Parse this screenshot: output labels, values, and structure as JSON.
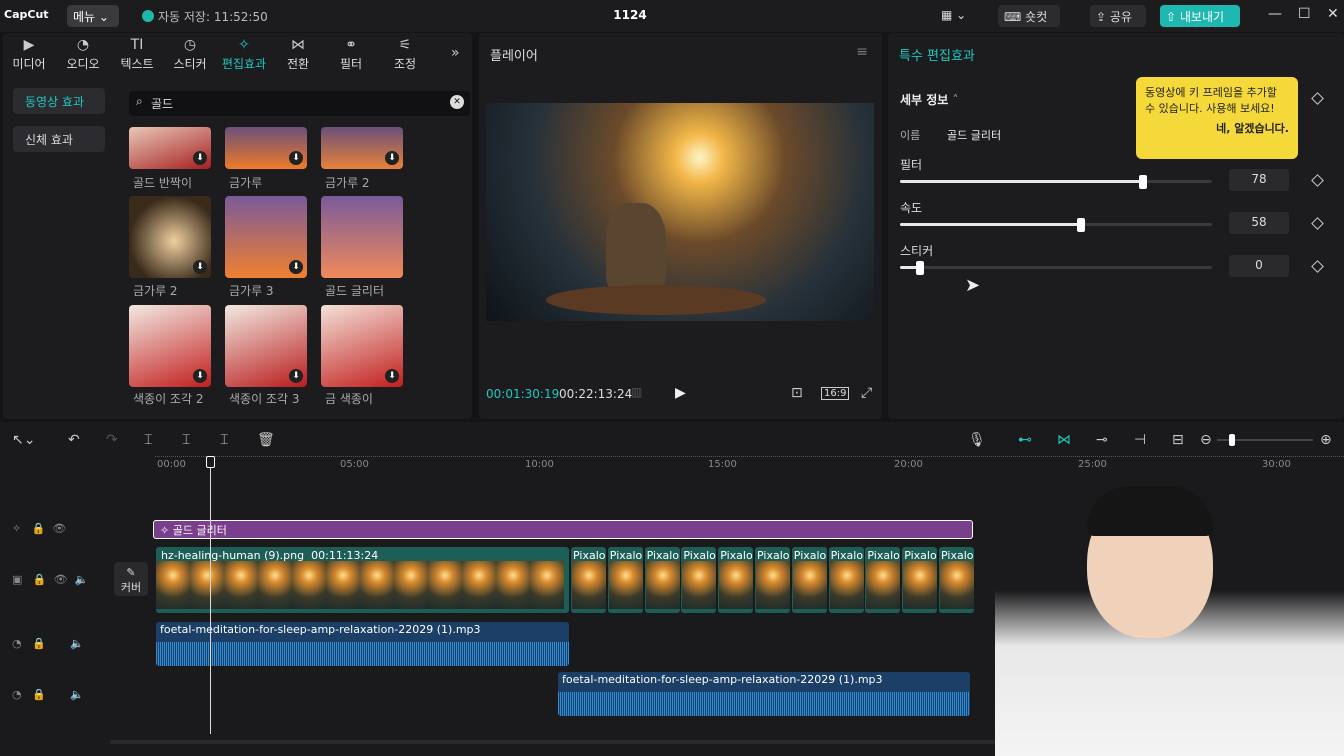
{
  "titlebar": {
    "logo": "CapCut",
    "menu": "메뉴",
    "autosave": "자동 저장: 11:52:50",
    "project": "1124",
    "shortcut": "숏컷",
    "share": "공유",
    "export": "내보내기"
  },
  "left_panel": {
    "tools": [
      "미디어",
      "오디오",
      "텍스트",
      "스티커",
      "편집효과",
      "전환",
      "필터",
      "조정"
    ],
    "active_tool": "편집효과",
    "side": [
      "동영상 효과",
      "신체 효과"
    ],
    "search_value": "골드",
    "items": [
      {
        "label": "골드 반짝이"
      },
      {
        "label": "금가루"
      },
      {
        "label": "금가루 2"
      },
      {
        "label": "금가루 2"
      },
      {
        "label": "금가루 3"
      },
      {
        "label": "골드 글리터"
      },
      {
        "label": "색종이 조각 2"
      },
      {
        "label": "색종이 조각 3"
      },
      {
        "label": "금 색종이"
      }
    ]
  },
  "player": {
    "title": "플레이어",
    "current_time": "00:01:30:19",
    "total_time": "00:22:13:24",
    "ratio": "16:9"
  },
  "details": {
    "title": "특수 편집효과",
    "section": "세부 정보",
    "name_label": "이름",
    "name_value": "골드 글리터",
    "sliders": [
      {
        "label": "필터",
        "value": 78,
        "fraction": 0.78
      },
      {
        "label": "속도",
        "value": 58,
        "fraction": 0.58
      },
      {
        "label": "스티커",
        "value": 0,
        "fraction": 0.0
      }
    ],
    "tooltip_text": "동영상에 키 프레임을 추가할 수 있습니다. 사용해 보세요!",
    "tooltip_btn": "네, 알겠습니다."
  },
  "timeline": {
    "ruler": [
      "00:00",
      "05:00",
      "10:00",
      "15:00",
      "20:00",
      "25:00",
      "30:00"
    ],
    "effect_clip": "골드 글리터",
    "video_clip_name": "hz-healing-human (9).png",
    "video_clip_duration": "00:11:13:24",
    "pixalo_label": "Pixalo",
    "cover_label": "커버",
    "audio1": "foetal-meditation-for-sleep-amp-relaxation-22029 (1).mp3",
    "audio2": "foetal-meditation-for-sleep-amp-relaxation-22029 (1).mp3"
  },
  "colors": {
    "accent": "#1fc8c0",
    "effect_clip": "#7a3f8c",
    "video_clip": "#1d5f57",
    "audio_clip": "#1b3f66",
    "tooltip": "#f5d93a"
  }
}
